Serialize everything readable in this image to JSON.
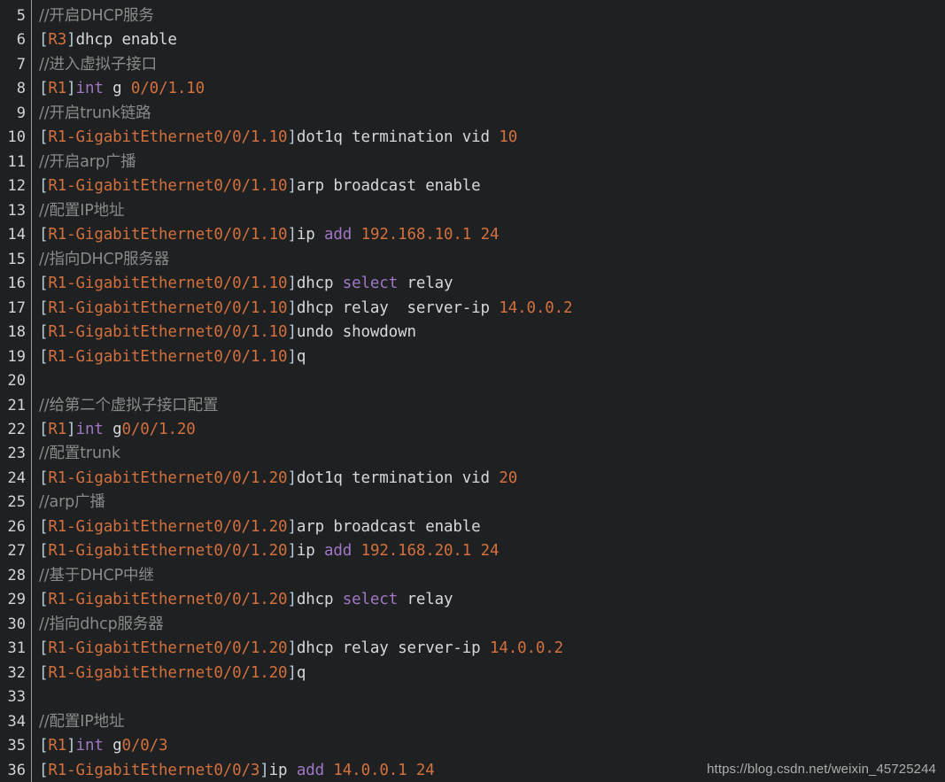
{
  "editor": {
    "name": "code-block",
    "language": "huawei-vrp-cli",
    "background_color": "#1e2021",
    "gutter_separator_color": "#9b9b9b",
    "first_line_number": 5,
    "last_line_number": 36
  },
  "theme": {
    "comment": "#8a8a8a",
    "punctuation": "#b8ccd6",
    "prompt": "#d3703d",
    "plain": "#d4d9dd",
    "keyword": "#a077c4",
    "number": "#d3703d",
    "line_number": "#d4d4d4"
  },
  "watermark": {
    "text": "https://blog.csdn.net/weixin_45725244"
  },
  "lines": [
    {
      "number": "5",
      "tokens": [
        {
          "c": "comment",
          "t": "//开启DHCP服务"
        }
      ]
    },
    {
      "number": "6",
      "tokens": [
        {
          "c": "punct",
          "t": "["
        },
        {
          "c": "prompt",
          "t": "R3"
        },
        {
          "c": "punct",
          "t": "]"
        },
        {
          "c": "plain",
          "t": "dhcp enable"
        }
      ]
    },
    {
      "number": "7",
      "tokens": [
        {
          "c": "comment",
          "t": "//进入虚拟子接口"
        }
      ]
    },
    {
      "number": "8",
      "tokens": [
        {
          "c": "punct",
          "t": "["
        },
        {
          "c": "prompt",
          "t": "R1"
        },
        {
          "c": "punct",
          "t": "]"
        },
        {
          "c": "kw",
          "t": "int"
        },
        {
          "c": "plain",
          "t": " g "
        },
        {
          "c": "num",
          "t": "0/0/1.10"
        }
      ]
    },
    {
      "number": "9",
      "tokens": [
        {
          "c": "comment",
          "t": "//开启trunk链路"
        }
      ]
    },
    {
      "number": "10",
      "tokens": [
        {
          "c": "punct",
          "t": "["
        },
        {
          "c": "prompt",
          "t": "R1-GigabitEthernet0/0/1.10"
        },
        {
          "c": "punct",
          "t": "]"
        },
        {
          "c": "plain",
          "t": "dot1q termination vid "
        },
        {
          "c": "num",
          "t": "10"
        }
      ]
    },
    {
      "number": "11",
      "tokens": [
        {
          "c": "comment",
          "t": "//开启arp广播"
        }
      ]
    },
    {
      "number": "12",
      "tokens": [
        {
          "c": "punct",
          "t": "["
        },
        {
          "c": "prompt",
          "t": "R1-GigabitEthernet0/0/1.10"
        },
        {
          "c": "punct",
          "t": "]"
        },
        {
          "c": "plain",
          "t": "arp broadcast enable"
        }
      ]
    },
    {
      "number": "13",
      "tokens": [
        {
          "c": "comment",
          "t": "//配置IP地址"
        }
      ]
    },
    {
      "number": "14",
      "tokens": [
        {
          "c": "punct",
          "t": "["
        },
        {
          "c": "prompt",
          "t": "R1-GigabitEthernet0/0/1.10"
        },
        {
          "c": "punct",
          "t": "]"
        },
        {
          "c": "plain",
          "t": "ip "
        },
        {
          "c": "kw",
          "t": "add"
        },
        {
          "c": "plain",
          "t": " "
        },
        {
          "c": "num",
          "t": "192.168.10.1 24"
        }
      ]
    },
    {
      "number": "15",
      "tokens": [
        {
          "c": "comment",
          "t": "//指向DHCP服务器"
        }
      ]
    },
    {
      "number": "16",
      "tokens": [
        {
          "c": "punct",
          "t": "["
        },
        {
          "c": "prompt",
          "t": "R1-GigabitEthernet0/0/1.10"
        },
        {
          "c": "punct",
          "t": "]"
        },
        {
          "c": "plain",
          "t": "dhcp "
        },
        {
          "c": "kw",
          "t": "select"
        },
        {
          "c": "plain",
          "t": " relay"
        }
      ]
    },
    {
      "number": "17",
      "tokens": [
        {
          "c": "punct",
          "t": "["
        },
        {
          "c": "prompt",
          "t": "R1-GigabitEthernet0/0/1.10"
        },
        {
          "c": "punct",
          "t": "]"
        },
        {
          "c": "plain",
          "t": "dhcp relay  server-ip "
        },
        {
          "c": "num",
          "t": "14.0.0.2"
        }
      ]
    },
    {
      "number": "18",
      "tokens": [
        {
          "c": "punct",
          "t": "["
        },
        {
          "c": "prompt",
          "t": "R1-GigabitEthernet0/0/1.10"
        },
        {
          "c": "punct",
          "t": "]"
        },
        {
          "c": "plain",
          "t": "undo showdown"
        }
      ]
    },
    {
      "number": "19",
      "tokens": [
        {
          "c": "punct",
          "t": "["
        },
        {
          "c": "prompt",
          "t": "R1-GigabitEthernet0/0/1.10"
        },
        {
          "c": "punct",
          "t": "]"
        },
        {
          "c": "plain",
          "t": "q"
        }
      ]
    },
    {
      "number": "20",
      "tokens": []
    },
    {
      "number": "21",
      "tokens": [
        {
          "c": "comment",
          "t": "//给第二个虚拟子接口配置"
        }
      ]
    },
    {
      "number": "22",
      "tokens": [
        {
          "c": "punct",
          "t": "["
        },
        {
          "c": "prompt",
          "t": "R1"
        },
        {
          "c": "punct",
          "t": "]"
        },
        {
          "c": "kw",
          "t": "int"
        },
        {
          "c": "plain",
          "t": " g"
        },
        {
          "c": "num",
          "t": "0/0/1.20"
        }
      ]
    },
    {
      "number": "23",
      "tokens": [
        {
          "c": "comment",
          "t": "//配置trunk"
        }
      ]
    },
    {
      "number": "24",
      "tokens": [
        {
          "c": "punct",
          "t": "["
        },
        {
          "c": "prompt",
          "t": "R1-GigabitEthernet0/0/1.20"
        },
        {
          "c": "punct",
          "t": "]"
        },
        {
          "c": "plain",
          "t": "dot1q termination vid "
        },
        {
          "c": "num",
          "t": "20"
        }
      ]
    },
    {
      "number": "25",
      "tokens": [
        {
          "c": "comment",
          "t": "//arp广播"
        }
      ]
    },
    {
      "number": "26",
      "tokens": [
        {
          "c": "punct",
          "t": "["
        },
        {
          "c": "prompt",
          "t": "R1-GigabitEthernet0/0/1.20"
        },
        {
          "c": "punct",
          "t": "]"
        },
        {
          "c": "plain",
          "t": "arp broadcast enable"
        }
      ]
    },
    {
      "number": "27",
      "tokens": [
        {
          "c": "punct",
          "t": "["
        },
        {
          "c": "prompt",
          "t": "R1-GigabitEthernet0/0/1.20"
        },
        {
          "c": "punct",
          "t": "]"
        },
        {
          "c": "plain",
          "t": "ip "
        },
        {
          "c": "kw",
          "t": "add"
        },
        {
          "c": "plain",
          "t": " "
        },
        {
          "c": "num",
          "t": "192.168.20.1 24"
        }
      ]
    },
    {
      "number": "28",
      "tokens": [
        {
          "c": "comment",
          "t": "//基于DHCP中继"
        }
      ]
    },
    {
      "number": "29",
      "tokens": [
        {
          "c": "punct",
          "t": "["
        },
        {
          "c": "prompt",
          "t": "R1-GigabitEthernet0/0/1.20"
        },
        {
          "c": "punct",
          "t": "]"
        },
        {
          "c": "plain",
          "t": "dhcp "
        },
        {
          "c": "kw",
          "t": "select"
        },
        {
          "c": "plain",
          "t": " relay"
        }
      ]
    },
    {
      "number": "30",
      "tokens": [
        {
          "c": "comment",
          "t": "//指向dhcp服务器"
        }
      ]
    },
    {
      "number": "31",
      "tokens": [
        {
          "c": "punct",
          "t": "["
        },
        {
          "c": "prompt",
          "t": "R1-GigabitEthernet0/0/1.20"
        },
        {
          "c": "punct",
          "t": "]"
        },
        {
          "c": "plain",
          "t": "dhcp relay server-ip "
        },
        {
          "c": "num",
          "t": "14.0.0.2"
        }
      ]
    },
    {
      "number": "32",
      "tokens": [
        {
          "c": "punct",
          "t": "["
        },
        {
          "c": "prompt",
          "t": "R1-GigabitEthernet0/0/1.20"
        },
        {
          "c": "punct",
          "t": "]"
        },
        {
          "c": "plain",
          "t": "q"
        }
      ]
    },
    {
      "number": "33",
      "tokens": []
    },
    {
      "number": "34",
      "tokens": [
        {
          "c": "comment",
          "t": "//配置IP地址"
        }
      ]
    },
    {
      "number": "35",
      "tokens": [
        {
          "c": "punct",
          "t": "["
        },
        {
          "c": "prompt",
          "t": "R1"
        },
        {
          "c": "punct",
          "t": "]"
        },
        {
          "c": "kw",
          "t": "int"
        },
        {
          "c": "plain",
          "t": " g"
        },
        {
          "c": "num",
          "t": "0/0/3"
        }
      ]
    },
    {
      "number": "36",
      "tokens": [
        {
          "c": "punct",
          "t": "["
        },
        {
          "c": "prompt",
          "t": "R1-GigabitEthernet0/0/3"
        },
        {
          "c": "punct",
          "t": "]"
        },
        {
          "c": "plain",
          "t": "ip "
        },
        {
          "c": "kw",
          "t": "add"
        },
        {
          "c": "plain",
          "t": " "
        },
        {
          "c": "num",
          "t": "14.0.0.1 24"
        }
      ]
    }
  ]
}
